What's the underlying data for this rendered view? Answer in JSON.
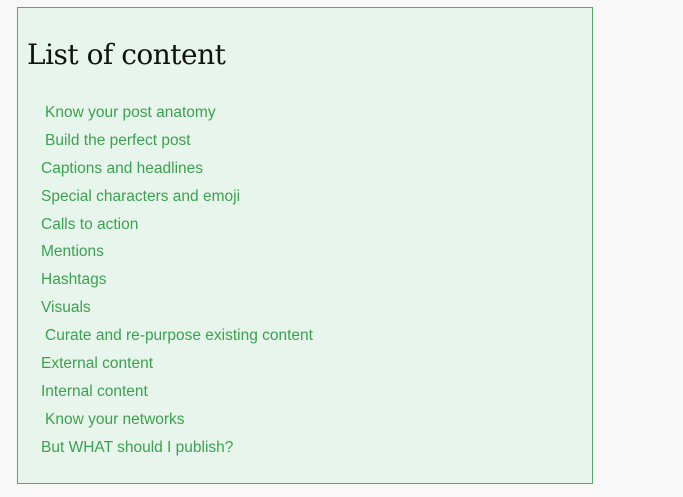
{
  "toc": {
    "title": "List of content",
    "items": [
      {
        "label": "Know your post anatomy",
        "level": 1
      },
      {
        "label": "Build the perfect post",
        "level": 1
      },
      {
        "label": "Captions and headlines",
        "level": 2
      },
      {
        "label": "Special characters and emoji",
        "level": 2
      },
      {
        "label": "Calls to action",
        "level": 2
      },
      {
        "label": "Mentions",
        "level": 2
      },
      {
        "label": "Hashtags",
        "level": 2
      },
      {
        "label": "Visuals",
        "level": 2
      },
      {
        "label": "Curate and re-purpose existing content",
        "level": 1
      },
      {
        "label": "External content",
        "level": 2
      },
      {
        "label": "Internal content",
        "level": 2
      },
      {
        "label": "Know your networks",
        "level": 1
      },
      {
        "label": "But WHAT should I publish?",
        "level": 2
      }
    ]
  },
  "colors": {
    "link": "#3aa24e",
    "box_background": "#e8f5ec",
    "box_border": "#4caf5f"
  }
}
